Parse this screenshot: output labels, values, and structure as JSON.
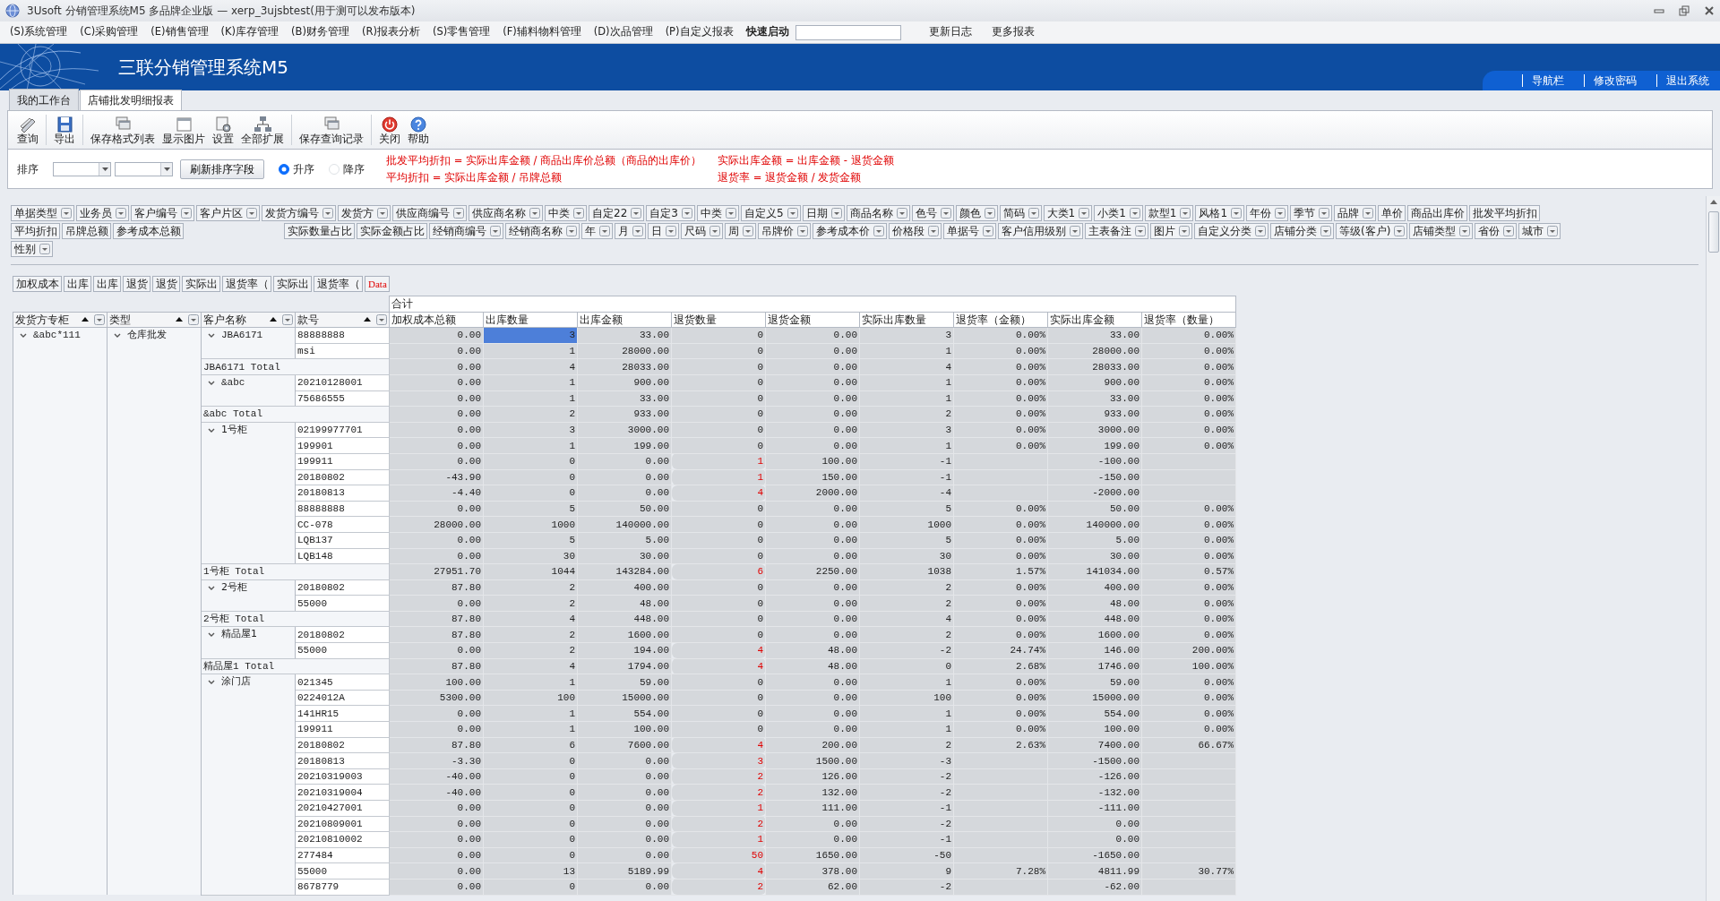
{
  "window": {
    "title": "3Usoft 分销管理系统M5 多品牌企业版 — xerp_3ujsbtest(用于测可以发布版本)"
  },
  "menu": [
    "(S)系统管理",
    "(C)采购管理",
    "(E)销售管理",
    "(K)库存管理",
    "(B)财务管理",
    "(R)报表分析",
    "(S)零售管理",
    "(F)辅料物料管理",
    "(D)次品管理",
    "(P)自定义报表"
  ],
  "quick_launch": {
    "label": "快速启动"
  },
  "menu_links": [
    "更新日志",
    "更多报表"
  ],
  "banner": {
    "title": "三联分销管理系统M5",
    "links": [
      "导航栏",
      "修改密码",
      "退出系统"
    ]
  },
  "tabs": [
    {
      "label": "我的工作台",
      "selected": false
    },
    {
      "label": "店铺批发明细报表",
      "selected": true
    }
  ],
  "toolbar": [
    "查询",
    "导出",
    "保存格式列表",
    "显示图片",
    "设置",
    "全部扩展",
    "保存查询记录",
    "关闭",
    "帮助"
  ],
  "sort_panel": {
    "label": "排序",
    "button": "刷新排序字段",
    "options": [
      {
        "label": "升序",
        "selected": true
      },
      {
        "label": "降序",
        "selected": false
      }
    ],
    "formulas": [
      "批发平均折扣 = 实际出库金额 / 商品出库价总额（商品的出库价）",
      "实际出库金额 = 出库金额 - 退货金额",
      "平均折扣 = 实际出库金额 / 吊牌总额",
      "退货率 = 退货金额 / 发货金额"
    ]
  },
  "field_rows": [
    [
      {
        "label": "单据类型",
        "filter": true
      },
      {
        "label": "业务员",
        "filter": true
      },
      {
        "label": "客户编号",
        "filter": true
      },
      {
        "label": "客户片区",
        "filter": true
      },
      {
        "label": "发货方编号",
        "filter": true
      },
      {
        "label": "发货方",
        "filter": true
      },
      {
        "label": "供应商编号",
        "filter": true
      },
      {
        "label": "供应商名称",
        "filter": true
      },
      {
        "label": "中类",
        "filter": true
      },
      {
        "label": "自定22",
        "filter": true
      },
      {
        "label": "自定3",
        "filter": true
      },
      {
        "label": "中类",
        "filter": true
      },
      {
        "label": "自定义5",
        "filter": true
      },
      {
        "label": "日期",
        "filter": true
      },
      {
        "label": "商品名称",
        "filter": true
      },
      {
        "label": "色号",
        "filter": true
      },
      {
        "label": "颜色",
        "filter": true
      },
      {
        "label": "简码",
        "filter": true
      },
      {
        "label": "大类1",
        "filter": true
      },
      {
        "label": "小类1",
        "filter": true
      },
      {
        "label": "款型1",
        "filter": true
      },
      {
        "label": "风格1",
        "filter": true
      },
      {
        "label": "年份",
        "filter": true
      },
      {
        "label": "季节",
        "filter": true
      },
      {
        "label": "品牌",
        "filter": true
      },
      {
        "label": "单价",
        "filter": false
      },
      {
        "label": "商品出库价",
        "filter": false
      },
      {
        "label": "批发平均折扣",
        "filter": false
      }
    ],
    [
      {
        "label": "平均折扣",
        "filter": false
      },
      {
        "label": "吊牌总额",
        "filter": false
      },
      {
        "label": "参考成本总额",
        "filter": false
      },
      {
        "label": "实际数量占比",
        "filter": false
      },
      {
        "label": "实际金额占比",
        "filter": false
      },
      {
        "label": "经销商编号",
        "filter": true
      },
      {
        "label": "经销商名称",
        "filter": true
      },
      {
        "label": "年",
        "filter": true
      },
      {
        "label": "月",
        "filter": true
      },
      {
        "label": "日",
        "filter": true
      },
      {
        "label": "尺码",
        "filter": true
      },
      {
        "label": "周",
        "filter": true
      },
      {
        "label": "吊牌价",
        "filter": true
      },
      {
        "label": "参考成本价",
        "filter": true
      },
      {
        "label": "价格段",
        "filter": true
      },
      {
        "label": "单据号",
        "filter": true
      },
      {
        "label": "客户信用级别",
        "filter": true
      },
      {
        "label": "主表备注",
        "filter": true
      },
      {
        "label": "图片",
        "filter": true
      },
      {
        "label": "自定义分类",
        "filter": true
      },
      {
        "label": "店铺分类",
        "filter": true
      },
      {
        "label": "等级(客户)",
        "filter": true
      },
      {
        "label": "店铺类型",
        "filter": true
      },
      {
        "label": "省份",
        "filter": true
      },
      {
        "label": "城市",
        "filter": true
      }
    ],
    [
      {
        "label": "性别",
        "filter": true
      }
    ]
  ],
  "data_chips": [
    {
      "label": "加权成本",
      "kind": "field"
    },
    {
      "label": "出库",
      "kind": "field"
    },
    {
      "label": "出库",
      "kind": "field"
    },
    {
      "label": "退货",
      "kind": "field"
    },
    {
      "label": "退货",
      "kind": "field"
    },
    {
      "label": "实际出",
      "kind": "field"
    },
    {
      "label": "退货率（",
      "kind": "field"
    },
    {
      "label": "实际出",
      "kind": "field"
    },
    {
      "label": "退货率（",
      "kind": "field"
    },
    {
      "label": "Data",
      "kind": "data"
    }
  ],
  "table": {
    "group_header": "合计",
    "row_columns": [
      {
        "label": "发货方专柜",
        "sorted": true
      },
      {
        "label": "类型",
        "sorted": true
      },
      {
        "label": "客户名称",
        "sorted": true
      },
      {
        "label": "款号",
        "sorted": true
      }
    ],
    "value_columns": [
      {
        "label": "加权成本总额",
        "selected": false
      },
      {
        "label": "出库数量",
        "selected": true
      },
      {
        "label": "出库金额",
        "selected": false
      },
      {
        "label": "退货数量",
        "selected": false
      },
      {
        "label": "退货金额",
        "selected": false
      },
      {
        "label": "实际出库数量",
        "selected": false
      },
      {
        "label": "退货率（金额）",
        "selected": false
      },
      {
        "label": "实际出库金额",
        "selected": false
      },
      {
        "label": "退货率（数量）",
        "selected": false
      }
    ],
    "dimension1": {
      "label": "&abc*111",
      "expanded": true
    },
    "dimension2": {
      "label": "仓库批发",
      "expanded": true
    },
    "groups": [
      {
        "customer": "JBA6171",
        "expanded": true,
        "rows": [
          {
            "style_no": "88888888",
            "selected": true,
            "return_alert": false,
            "values": {
              "weighted_cost": "0.00",
              "out_qty": "3",
              "out_amount": "33.00",
              "return_qty": "0",
              "return_amount": "0.00",
              "actual_qty": "3",
              "return_rate_amount": "0.00%",
              "actual_amount": "33.00",
              "return_rate_qty": "0.00%"
            }
          },
          {
            "style_no": "msi",
            "selected": false,
            "return_alert": false,
            "values": {
              "weighted_cost": "0.00",
              "out_qty": "1",
              "out_amount": "28000.00",
              "return_qty": "0",
              "return_amount": "0.00",
              "actual_qty": "1",
              "return_rate_amount": "0.00%",
              "actual_amount": "28000.00",
              "return_rate_qty": "0.00%"
            }
          }
        ],
        "total": {
          "label": "JBA6171 Total",
          "return_alert": false,
          "values": {
            "weighted_cost": "0.00",
            "out_qty": "4",
            "out_amount": "28033.00",
            "return_qty": "0",
            "return_amount": "0.00",
            "actual_qty": "4",
            "return_rate_amount": "0.00%",
            "actual_amount": "28033.00",
            "return_rate_qty": "0.00%"
          }
        }
      },
      {
        "customer": "&abc",
        "expanded": true,
        "rows": [
          {
            "style_no": "20210128001",
            "selected": false,
            "return_alert": false,
            "values": {
              "weighted_cost": "0.00",
              "out_qty": "1",
              "out_amount": "900.00",
              "return_qty": "0",
              "return_amount": "0.00",
              "actual_qty": "1",
              "return_rate_amount": "0.00%",
              "actual_amount": "900.00",
              "return_rate_qty": "0.00%"
            }
          },
          {
            "style_no": "75686555",
            "selected": false,
            "return_alert": false,
            "values": {
              "weighted_cost": "0.00",
              "out_qty": "1",
              "out_amount": "33.00",
              "return_qty": "0",
              "return_amount": "0.00",
              "actual_qty": "1",
              "return_rate_amount": "0.00%",
              "actual_amount": "33.00",
              "return_rate_qty": "0.00%"
            }
          }
        ],
        "total": {
          "label": "&abc Total",
          "return_alert": false,
          "values": {
            "weighted_cost": "0.00",
            "out_qty": "2",
            "out_amount": "933.00",
            "return_qty": "0",
            "return_amount": "0.00",
            "actual_qty": "2",
            "return_rate_amount": "0.00%",
            "actual_amount": "933.00",
            "return_rate_qty": "0.00%"
          }
        }
      },
      {
        "customer": "1号柜",
        "expanded": true,
        "rows": [
          {
            "style_no": "02199977701",
            "selected": false,
            "return_alert": false,
            "values": {
              "weighted_cost": "0.00",
              "out_qty": "3",
              "out_amount": "3000.00",
              "return_qty": "0",
              "return_amount": "0.00",
              "actual_qty": "3",
              "return_rate_amount": "0.00%",
              "actual_amount": "3000.00",
              "return_rate_qty": "0.00%"
            }
          },
          {
            "style_no": "199901",
            "selected": false,
            "return_alert": false,
            "values": {
              "weighted_cost": "0.00",
              "out_qty": "1",
              "out_amount": "199.00",
              "return_qty": "0",
              "return_amount": "0.00",
              "actual_qty": "1",
              "return_rate_amount": "0.00%",
              "actual_amount": "199.00",
              "return_rate_qty": "0.00%"
            }
          },
          {
            "style_no": "199911",
            "selected": false,
            "return_alert": true,
            "values": {
              "weighted_cost": "0.00",
              "out_qty": "0",
              "out_amount": "0.00",
              "return_qty": "1",
              "return_amount": "100.00",
              "actual_qty": "-1",
              "actual_amount": "-100.00"
            }
          },
          {
            "style_no": "20180802",
            "selected": false,
            "return_alert": true,
            "values": {
              "weighted_cost": "-43.90",
              "out_qty": "0",
              "out_amount": "0.00",
              "return_qty": "1",
              "return_amount": "150.00",
              "actual_qty": "-1",
              "actual_amount": "-150.00"
            }
          },
          {
            "style_no": "20180813",
            "selected": false,
            "return_alert": true,
            "values": {
              "weighted_cost": "-4.40",
              "out_qty": "0",
              "out_amount": "0.00",
              "return_qty": "4",
              "return_amount": "2000.00",
              "actual_qty": "-4",
              "actual_amount": "-2000.00"
            }
          },
          {
            "style_no": "88888888",
            "selected": false,
            "return_alert": false,
            "values": {
              "weighted_cost": "0.00",
              "out_qty": "5",
              "out_amount": "50.00",
              "return_qty": "0",
              "return_amount": "0.00",
              "actual_qty": "5",
              "return_rate_amount": "0.00%",
              "actual_amount": "50.00",
              "return_rate_qty": "0.00%"
            }
          },
          {
            "style_no": "CC-078",
            "selected": false,
            "return_alert": false,
            "values": {
              "weighted_cost": "28000.00",
              "out_qty": "1000",
              "out_amount": "140000.00",
              "return_qty": "0",
              "return_amount": "0.00",
              "actual_qty": "1000",
              "return_rate_amount": "0.00%",
              "actual_amount": "140000.00",
              "return_rate_qty": "0.00%"
            }
          },
          {
            "style_no": "LQB137",
            "selected": false,
            "return_alert": false,
            "values": {
              "weighted_cost": "0.00",
              "out_qty": "5",
              "out_amount": "5.00",
              "return_qty": "0",
              "return_amount": "0.00",
              "actual_qty": "5",
              "return_rate_amount": "0.00%",
              "actual_amount": "5.00",
              "return_rate_qty": "0.00%"
            }
          },
          {
            "style_no": "LQB148",
            "selected": false,
            "return_alert": false,
            "values": {
              "weighted_cost": "0.00",
              "out_qty": "30",
              "out_amount": "30.00",
              "return_qty": "0",
              "return_amount": "0.00",
              "actual_qty": "30",
              "return_rate_amount": "0.00%",
              "actual_amount": "30.00",
              "return_rate_qty": "0.00%"
            }
          }
        ],
        "total": {
          "label": "1号柜 Total",
          "return_alert": true,
          "values": {
            "weighted_cost": "27951.70",
            "out_qty": "1044",
            "out_amount": "143284.00",
            "return_qty": "6",
            "return_amount": "2250.00",
            "actual_qty": "1038",
            "return_rate_amount": "1.57%",
            "actual_amount": "141034.00",
            "return_rate_qty": "0.57%"
          }
        }
      },
      {
        "customer": "2号柜",
        "expanded": true,
        "rows": [
          {
            "style_no": "20180802",
            "selected": false,
            "return_alert": false,
            "values": {
              "weighted_cost": "87.80",
              "out_qty": "2",
              "out_amount": "400.00",
              "return_qty": "0",
              "return_amount": "0.00",
              "actual_qty": "2",
              "return_rate_amount": "0.00%",
              "actual_amount": "400.00",
              "return_rate_qty": "0.00%"
            }
          },
          {
            "style_no": "55000",
            "selected": false,
            "return_alert": false,
            "values": {
              "weighted_cost": "0.00",
              "out_qty": "2",
              "out_amount": "48.00",
              "return_qty": "0",
              "return_amount": "0.00",
              "actual_qty": "2",
              "return_rate_amount": "0.00%",
              "actual_amount": "48.00",
              "return_rate_qty": "0.00%"
            }
          }
        ],
        "total": {
          "label": "2号柜 Total",
          "return_alert": false,
          "values": {
            "weighted_cost": "87.80",
            "out_qty": "4",
            "out_amount": "448.00",
            "return_qty": "0",
            "return_amount": "0.00",
            "actual_qty": "4",
            "return_rate_amount": "0.00%",
            "actual_amount": "448.00",
            "return_rate_qty": "0.00%"
          }
        }
      },
      {
        "customer": "精品屋1",
        "expanded": true,
        "rows": [
          {
            "style_no": "20180802",
            "selected": false,
            "return_alert": false,
            "values": {
              "weighted_cost": "87.80",
              "out_qty": "2",
              "out_amount": "1600.00",
              "return_qty": "0",
              "return_amount": "0.00",
              "actual_qty": "2",
              "return_rate_amount": "0.00%",
              "actual_amount": "1600.00",
              "return_rate_qty": "0.00%"
            }
          },
          {
            "style_no": "55000",
            "selected": false,
            "return_alert": true,
            "values": {
              "weighted_cost": "0.00",
              "out_qty": "2",
              "out_amount": "194.00",
              "return_qty": "4",
              "return_amount": "48.00",
              "actual_qty": "-2",
              "return_rate_amount": "24.74%",
              "actual_amount": "146.00",
              "return_rate_qty": "200.00%"
            }
          }
        ],
        "total": {
          "label": "精品屋1 Total",
          "return_alert": true,
          "values": {
            "weighted_cost": "87.80",
            "out_qty": "4",
            "out_amount": "1794.00",
            "return_qty": "4",
            "return_amount": "48.00",
            "actual_qty": "0",
            "return_rate_amount": "2.68%",
            "actual_amount": "1746.00",
            "return_rate_qty": "100.00%"
          }
        }
      },
      {
        "customer": "涂门店",
        "expanded": true,
        "rows": [
          {
            "style_no": "021345",
            "selected": false,
            "return_alert": false,
            "values": {
              "weighted_cost": "100.00",
              "out_qty": "1",
              "out_amount": "59.00",
              "return_qty": "0",
              "return_amount": "0.00",
              "actual_qty": "1",
              "return_rate_amount": "0.00%",
              "actual_amount": "59.00",
              "return_rate_qty": "0.00%"
            }
          },
          {
            "style_no": "0224012A",
            "selected": false,
            "return_alert": false,
            "values": {
              "weighted_cost": "5300.00",
              "out_qty": "100",
              "out_amount": "15000.00",
              "return_qty": "0",
              "return_amount": "0.00",
              "actual_qty": "100",
              "return_rate_amount": "0.00%",
              "actual_amount": "15000.00",
              "return_rate_qty": "0.00%"
            }
          },
          {
            "style_no": "141HR15",
            "selected": false,
            "return_alert": false,
            "values": {
              "weighted_cost": "0.00",
              "out_qty": "1",
              "out_amount": "554.00",
              "return_qty": "0",
              "return_amount": "0.00",
              "actual_qty": "1",
              "return_rate_amount": "0.00%",
              "actual_amount": "554.00",
              "return_rate_qty": "0.00%"
            }
          },
          {
            "style_no": "199911",
            "selected": false,
            "return_alert": false,
            "values": {
              "weighted_cost": "0.00",
              "out_qty": "1",
              "out_amount": "100.00",
              "return_qty": "0",
              "return_amount": "0.00",
              "actual_qty": "1",
              "return_rate_amount": "0.00%",
              "actual_amount": "100.00",
              "return_rate_qty": "0.00%"
            }
          },
          {
            "style_no": "20180802",
            "selected": false,
            "return_alert": true,
            "values": {
              "weighted_cost": "87.80",
              "out_qty": "6",
              "out_amount": "7600.00",
              "return_qty": "4",
              "return_amount": "200.00",
              "actual_qty": "2",
              "return_rate_amount": "2.63%",
              "actual_amount": "7400.00",
              "return_rate_qty": "66.67%"
            }
          },
          {
            "style_no": "20180813",
            "selected": false,
            "return_alert": true,
            "values": {
              "weighted_cost": "-3.30",
              "out_qty": "0",
              "out_amount": "0.00",
              "return_qty": "3",
              "return_amount": "1500.00",
              "actual_qty": "-3",
              "actual_amount": "-1500.00"
            }
          },
          {
            "style_no": "20210319003",
            "selected": false,
            "return_alert": true,
            "values": {
              "weighted_cost": "-40.00",
              "out_qty": "0",
              "out_amount": "0.00",
              "return_qty": "2",
              "return_amount": "126.00",
              "actual_qty": "-2",
              "actual_amount": "-126.00"
            }
          },
          {
            "style_no": "20210319004",
            "selected": false,
            "return_alert": true,
            "values": {
              "weighted_cost": "-40.00",
              "out_qty": "0",
              "out_amount": "0.00",
              "return_qty": "2",
              "return_amount": "132.00",
              "actual_qty": "-2",
              "actual_amount": "-132.00"
            }
          },
          {
            "style_no": "20210427001",
            "selected": false,
            "return_alert": true,
            "values": {
              "weighted_cost": "0.00",
              "out_qty": "0",
              "out_amount": "0.00",
              "return_qty": "1",
              "return_amount": "111.00",
              "actual_qty": "-1",
              "actual_amount": "-111.00"
            }
          },
          {
            "style_no": "20210809001",
            "selected": false,
            "return_alert": true,
            "values": {
              "weighted_cost": "0.00",
              "out_qty": "0",
              "out_amount": "0.00",
              "return_qty": "2",
              "return_amount": "0.00",
              "actual_qty": "-2",
              "actual_amount": "0.00"
            }
          },
          {
            "style_no": "20210810002",
            "selected": false,
            "return_alert": true,
            "values": {
              "weighted_cost": "0.00",
              "out_qty": "0",
              "out_amount": "0.00",
              "return_qty": "1",
              "return_amount": "0.00",
              "actual_qty": "-1",
              "actual_amount": "0.00"
            }
          },
          {
            "style_no": "277484",
            "selected": false,
            "return_alert": true,
            "values": {
              "weighted_cost": "0.00",
              "out_qty": "0",
              "out_amount": "0.00",
              "return_qty": "50",
              "return_amount": "1650.00",
              "actual_qty": "-50",
              "actual_amount": "-1650.00"
            }
          },
          {
            "style_no": "55000",
            "selected": false,
            "return_alert": true,
            "values": {
              "weighted_cost": "0.00",
              "out_qty": "13",
              "out_amount": "5189.99",
              "return_qty": "4",
              "return_amount": "378.00",
              "actual_qty": "9",
              "return_rate_amount": "7.28%",
              "actual_amount": "4811.99",
              "return_rate_qty": "30.77%"
            }
          },
          {
            "style_no": "8678779",
            "selected": false,
            "return_alert": true,
            "values": {
              "weighted_cost": "0.00",
              "out_qty": "0",
              "out_amount": "0.00",
              "return_qty": "2",
              "return_amount": "62.00",
              "actual_qty": "-2",
              "actual_amount": "-62.00"
            }
          }
        ]
      }
    ]
  }
}
